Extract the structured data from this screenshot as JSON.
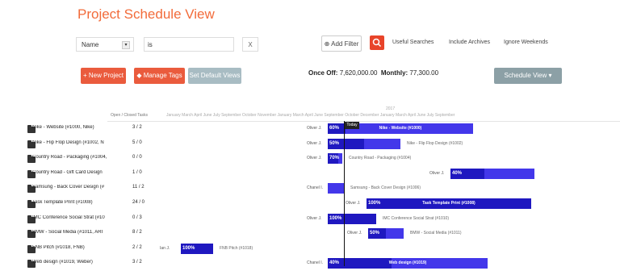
{
  "header": {
    "title": "Project Schedule View"
  },
  "filter": {
    "field": "Name",
    "operator": "is",
    "clear": "X",
    "add_filter": "Add Filter",
    "useful_searches": "Useful Searches",
    "include_archives": "Include Archives",
    "ignore_weekends": "Ignore Weekends"
  },
  "toolbar": {
    "new_project": "New Project",
    "manage_tags": "Manage Tags",
    "set_default": "Set Default Views",
    "schedule_view": "Schedule View",
    "once_off_label": "Once Off:",
    "once_off_value": "7,620,000.00",
    "monthly_label": "Monthly:",
    "monthly_value": "77,300.00"
  },
  "grid": {
    "col_header": "Open / Closed Tasks",
    "timeline": "January  March    April   June    July   September  October  November  January  March    April   June   September  October  December  January  March    April   June    July   September",
    "year_tag": "2017",
    "today": "Today"
  },
  "projects": [
    {
      "name": "Nike - Website (#1000, Nike)",
      "count": "3 / 2"
    },
    {
      "name": "Nike - Flip Flop Design (#1002, N",
      "count": "5 / 0"
    },
    {
      "name": "Country Road - Packaging (#1004,",
      "count": "0 / 0"
    },
    {
      "name": "Country Road - Gift Card Design",
      "count": "1 / 0"
    },
    {
      "name": "Samsung - Back Cover Design (#",
      "count": "11 / 2"
    },
    {
      "name": "Task Template Print (#1008)",
      "count": "24 / 0"
    },
    {
      "name": "IMC Conference Social Strat (#10",
      "count": "0 / 3"
    },
    {
      "name": "BMW - Social Media (#1011, ARI",
      "count": "8 / 2"
    },
    {
      "name": "FNB Pitch (#1018, FNB)",
      "count": "2 / 2"
    },
    {
      "name": "Web design (#1019, Weber)",
      "count": "3 / 2"
    }
  ],
  "bars": [
    {
      "owner": "Oliver J.",
      "pct": "60%",
      "label": "Nike - Website (#1000)",
      "progress": 0.12
    },
    {
      "owner": "Oliver J.",
      "pct": "50%",
      "label": "Nike - Flip Flop Design (#1002)",
      "progress": 0.5
    },
    {
      "owner": "Oliver J.",
      "pct": "70%",
      "label": "Country Road - Packaging (#1004)",
      "progress": 0.7
    },
    {
      "owner": "Oliver J.",
      "pct": "40%",
      "label": "",
      "progress": 0.4
    },
    {
      "owner": "Chanel I.",
      "pct": "",
      "label": "Samsung - Back Cover Design (#1006)",
      "progress": 0
    },
    {
      "owner": "Oliver J.",
      "pct": "100%",
      "label": "Task Template Print (#1008)",
      "progress": 1.0
    },
    {
      "owner": "Oliver J.",
      "pct": "100%",
      "label": "IMC Conference Social Strat (#1010)",
      "progress": 1.0
    },
    {
      "owner": "Oliver J.",
      "pct": "50%",
      "label": "BMW - Social Media (#1011)",
      "progress": 0.5
    },
    {
      "owner": "Ian J.",
      "pct": "100%",
      "label": "FNB Pitch (#1018)",
      "progress": 1.0
    },
    {
      "owner": "Chanel I.",
      "pct": "40%",
      "label": "Web design (#1019)",
      "progress": 0.4
    }
  ],
  "colors": {
    "accent": "#f26b3a",
    "button_red": "#ea5b3d",
    "bar": "#4337ea",
    "bar_progress": "#1f18c0"
  },
  "icons": {
    "project": "folder-icon",
    "search": "search-icon",
    "filter": "filter-icon",
    "tag": "tag-icon",
    "plus": "plus-icon"
  }
}
